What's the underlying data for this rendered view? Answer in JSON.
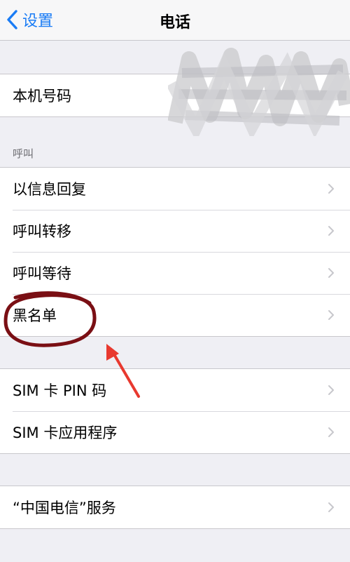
{
  "nav": {
    "back_label": "设置",
    "title": "电话"
  },
  "my_number": {
    "label": "本机号码"
  },
  "calls_section": {
    "header": "呼叫",
    "items": [
      {
        "label": "以信息回复",
        "icon": "chevron-right-icon"
      },
      {
        "label": "呼叫转移",
        "icon": "chevron-right-icon"
      },
      {
        "label": "呼叫等待",
        "icon": "chevron-right-icon"
      },
      {
        "label": "黑名单",
        "icon": "chevron-right-icon"
      }
    ]
  },
  "sim_section": {
    "items": [
      {
        "label": "SIM 卡 PIN 码",
        "icon": "chevron-right-icon"
      },
      {
        "label": "SIM 卡应用程序",
        "icon": "chevron-right-icon"
      }
    ]
  },
  "carrier_section": {
    "items": [
      {
        "label": "“中国电信”服务",
        "icon": "chevron-right-icon"
      }
    ]
  },
  "colors": {
    "accent": "#1a7cf5",
    "background": "#efeff4",
    "annotation_circle": "#7a0f14",
    "annotation_arrow": "#e8392f"
  }
}
